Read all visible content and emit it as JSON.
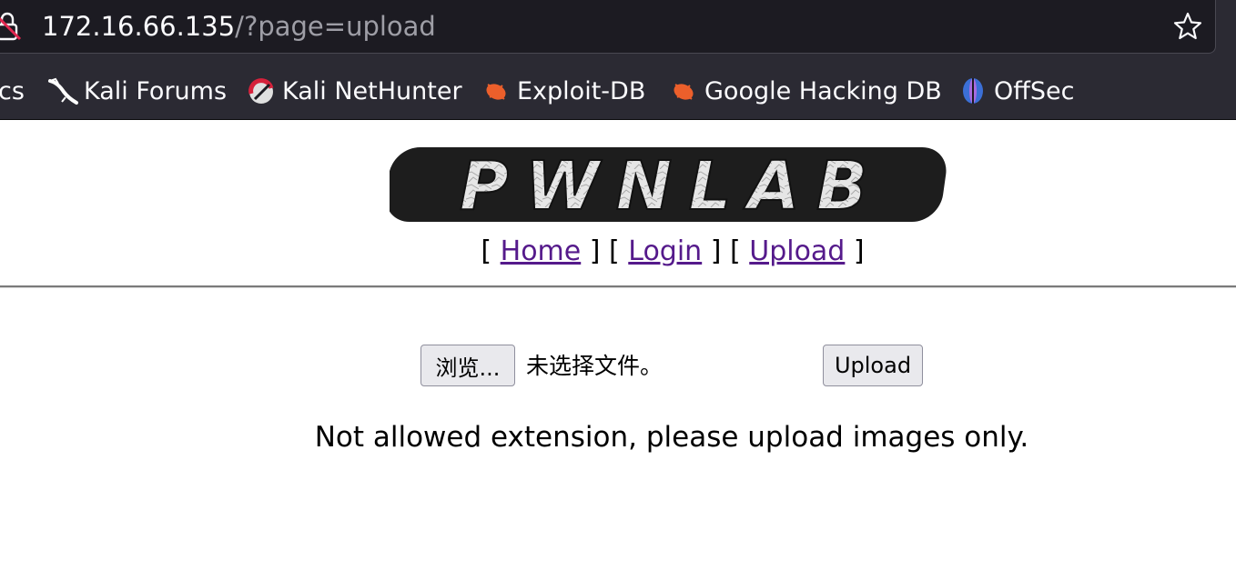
{
  "browser": {
    "url_host": "172.16.66.135",
    "url_path": "/?page=upload",
    "bookmarks": [
      {
        "label": "cs",
        "icon": "docs-icon"
      },
      {
        "label": "Kali Forums",
        "icon": "kali-dragon-icon"
      },
      {
        "label": "Kali NetHunter",
        "icon": "nethunter-icon"
      },
      {
        "label": "Exploit-DB",
        "icon": "exploit-db-icon"
      },
      {
        "label": "Google Hacking DB",
        "icon": "ghdb-icon"
      },
      {
        "label": "OffSec",
        "icon": "offsec-icon"
      }
    ]
  },
  "page": {
    "logo_text": "PWNLAB",
    "nav": {
      "home": "Home",
      "login": "Login",
      "upload": "Upload"
    },
    "form": {
      "browse_label": "浏览...",
      "file_status": "未选择文件。",
      "upload_label": "Upload"
    },
    "message": "Not allowed extension, please upload images only."
  },
  "colors": {
    "chrome_bg": "#2b2a33",
    "urlbar_bg": "#1c1b22",
    "link_visited": "#551a8b",
    "button_bg": "#e9e9ed"
  }
}
